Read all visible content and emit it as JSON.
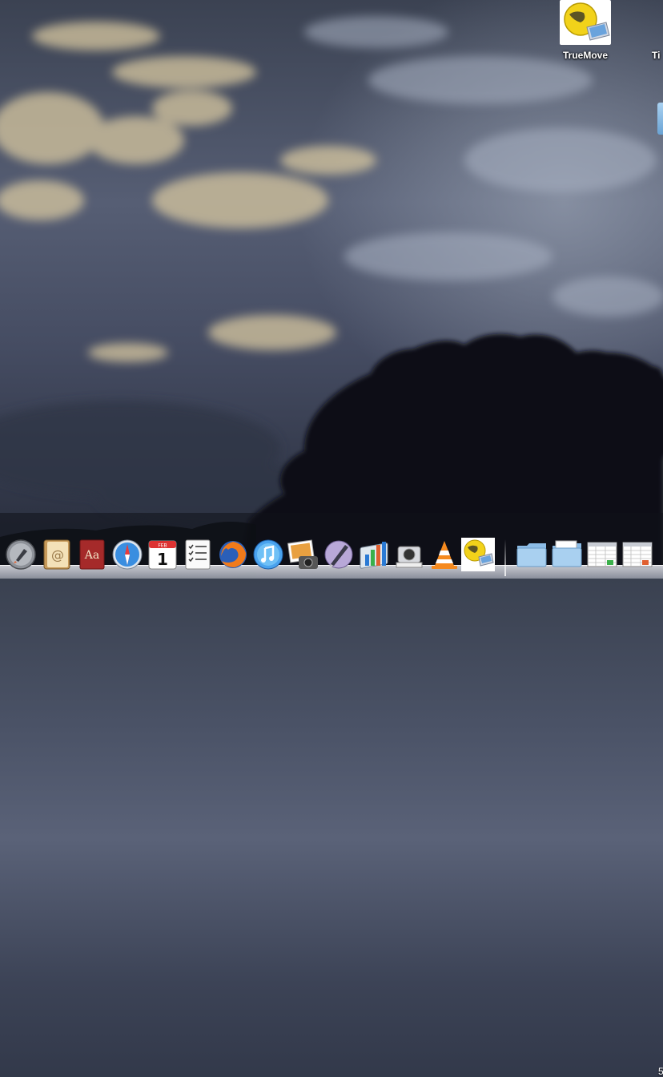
{
  "desktop": {
    "icons": [
      {
        "label": "TrueMove",
        "icon": "truemove-globe-laptop-icon"
      },
      {
        "label": "Ti",
        "icon": "partial-desktop-icon"
      }
    ]
  },
  "dock": {
    "apps": [
      {
        "name": "Launchpad",
        "icon": "launchpad-rocket-icon"
      },
      {
        "name": "Contacts",
        "icon": "address-book-icon"
      },
      {
        "name": "Dictionary",
        "icon": "dictionary-icon"
      },
      {
        "name": "Safari",
        "icon": "safari-compass-icon"
      },
      {
        "name": "Calendar",
        "icon": "calendar-icon",
        "month": "FEB",
        "day": "1"
      },
      {
        "name": "Reminders",
        "icon": "reminders-checklist-icon"
      },
      {
        "name": "Firefox",
        "icon": "firefox-icon"
      },
      {
        "name": "iTunes",
        "icon": "itunes-note-icon"
      },
      {
        "name": "iPhoto",
        "icon": "iphoto-camera-icon"
      },
      {
        "name": "Preview",
        "icon": "preview-pen-icon"
      },
      {
        "name": "Numbers",
        "icon": "numbers-chart-icon"
      },
      {
        "name": "Image Capture",
        "icon": "image-capture-camera-icon"
      },
      {
        "name": "VLC",
        "icon": "vlc-cone-icon"
      },
      {
        "name": "TrueMove",
        "icon": "truemove-globe-laptop-icon"
      },
      {
        "name": "Folder",
        "icon": "folder-icon"
      },
      {
        "name": "Folder",
        "icon": "folder-icon"
      },
      {
        "name": "Document",
        "icon": "document-spreadsheet-icon"
      },
      {
        "name": "Document",
        "icon": "document-spreadsheet-icon"
      }
    ],
    "edge_text": "5"
  }
}
